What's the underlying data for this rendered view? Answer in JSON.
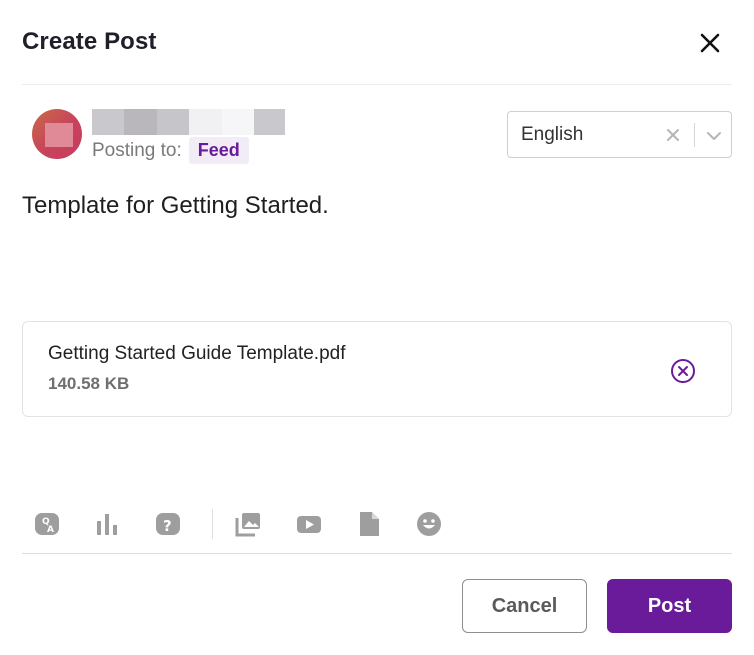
{
  "dialog": {
    "title": "Create Post"
  },
  "author": {
    "posting_label": "Posting to:",
    "destination": "Feed"
  },
  "language": {
    "selected": "English"
  },
  "post": {
    "text": "Template for Getting Started."
  },
  "attachment": {
    "file_name": "Getting Started Guide Template.pdf",
    "file_size": "140.58 KB"
  },
  "toolbar": {
    "tools": [
      "qa-icon",
      "poll-icon",
      "question-icon",
      "image-gallery-icon",
      "video-icon",
      "document-icon",
      "emoji-icon"
    ]
  },
  "actions": {
    "cancel_label": "Cancel",
    "post_label": "Post"
  },
  "colors": {
    "accent": "#6a1b9a",
    "chip_background": "#f1ecf6",
    "icon_gray": "#9e9e9e"
  }
}
